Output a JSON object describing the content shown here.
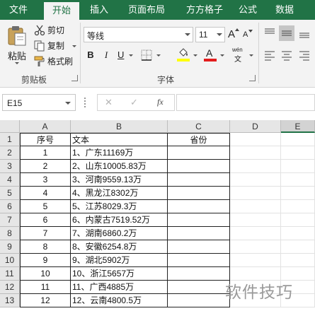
{
  "tabs": [
    {
      "label": "文件",
      "active": false
    },
    {
      "label": "开始",
      "active": true
    },
    {
      "label": "插入",
      "active": false
    },
    {
      "label": "页面布局",
      "active": false
    },
    {
      "label": "方方格子",
      "active": false
    },
    {
      "label": "公式",
      "active": false
    },
    {
      "label": "数据",
      "active": false
    }
  ],
  "clipboard": {
    "paste_label": "粘贴",
    "cut_label": "剪切",
    "copy_label": "复制",
    "format_painter_label": "格式刷",
    "group_label": "剪贴板"
  },
  "font": {
    "name_value": "等线",
    "size_value": "11",
    "bold": "B",
    "italic": "I",
    "underline": "U",
    "grow": "A",
    "shrink": "A",
    "font_color_letter": "A",
    "phonetic": "wén",
    "phonetic_sub": "文",
    "group_label": "字体",
    "fill_color": "#ffff00",
    "font_color": "#e31c1c"
  },
  "formula_bar": {
    "name_box": "E15",
    "fx_label": "fx",
    "cancel": "✕",
    "enter": "✓",
    "formula": ""
  },
  "columns": [
    "A",
    "B",
    "C",
    "D",
    "E"
  ],
  "rows": [
    {
      "n": "1",
      "a": "序号",
      "b": "文本",
      "c": "省份"
    },
    {
      "n": "2",
      "a": "1",
      "b": "1、广东11169万",
      "c": ""
    },
    {
      "n": "3",
      "a": "2",
      "b": "2、山东10005.83万",
      "c": ""
    },
    {
      "n": "4",
      "a": "3",
      "b": "3、河南9559.13万",
      "c": ""
    },
    {
      "n": "5",
      "a": "4",
      "b": "4、黑龙江8302万",
      "c": ""
    },
    {
      "n": "6",
      "a": "5",
      "b": "5、江苏8029.3万",
      "c": ""
    },
    {
      "n": "7",
      "a": "6",
      "b": "6、内蒙古7519.52万",
      "c": ""
    },
    {
      "n": "8",
      "a": "7",
      "b": "7、湖南6860.2万",
      "c": ""
    },
    {
      "n": "9",
      "a": "8",
      "b": "8、安徽6254.8万",
      "c": ""
    },
    {
      "n": "10",
      "a": "9",
      "b": "9、湖北5902万",
      "c": ""
    },
    {
      "n": "11",
      "a": "10",
      "b": "10、浙江5657万",
      "c": ""
    },
    {
      "n": "12",
      "a": "11",
      "b": "11、广西4885万",
      "c": ""
    },
    {
      "n": "13",
      "a": "12",
      "b": "12、云南4800.5万",
      "c": ""
    }
  ],
  "watermark": "软件技巧",
  "colors": {
    "accent": "#217346"
  }
}
